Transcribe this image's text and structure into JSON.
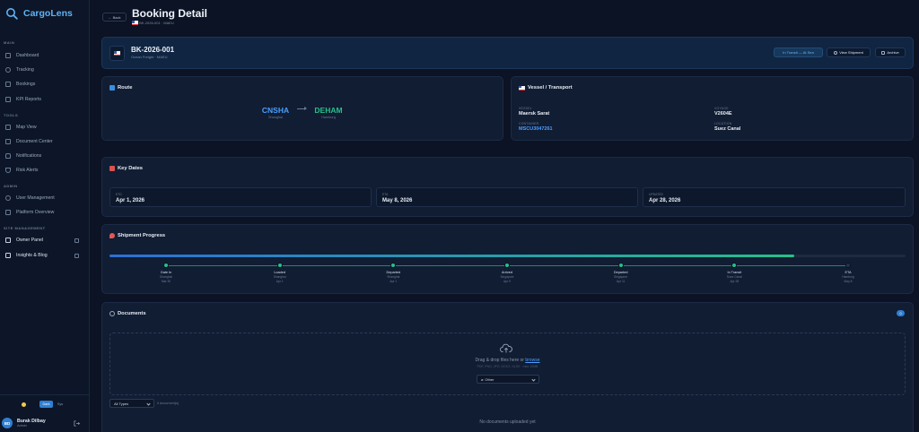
{
  "app": {
    "name": "CargoLens"
  },
  "sidebar": {
    "sections": [
      {
        "label": "MAIN",
        "items": [
          "Dashboard",
          "Tracking",
          "Bookings",
          "KPI Reports"
        ]
      },
      {
        "label": "TOOLS",
        "items": [
          "Map View",
          "Document Center",
          "Notifications",
          "Risk Alerts"
        ]
      },
      {
        "label": "ADMIN",
        "items": [
          "User Management",
          "Platform Overview"
        ]
      },
      {
        "label": "SITE MANAGEMENT",
        "items": [
          "Owner Panel",
          "Insights & Blog"
        ]
      }
    ],
    "theme": {
      "options": [
        "Dark",
        "Sys"
      ],
      "selected": "Dark"
    },
    "user": {
      "initials": "BD",
      "name": "Burak Dilbay",
      "role": "Admin"
    }
  },
  "header": {
    "back_label": "← Back",
    "title": "Booking Detail",
    "subtitle": "BK-2026-001 · MAEU"
  },
  "booking": {
    "number": "BK-2026-001",
    "subtitle": "Ocean Freight · MAEU",
    "status": "In Transit — At Sea",
    "view_label": "View Shipment",
    "archive_label": "Archive"
  },
  "route": {
    "title": "Route",
    "origin": {
      "code": "CNSHA",
      "city": "Shanghai",
      "color": "#4a9eff"
    },
    "destination": {
      "code": "DEHAM",
      "city": "Hamburg",
      "color": "#27c08a"
    }
  },
  "vessel": {
    "title": "Vessel / Transport",
    "fields": [
      {
        "label": "VESSEL",
        "value": "Maersk Sarat",
        "link": false
      },
      {
        "label": "VOYAGE",
        "value": "V2604E",
        "link": false
      },
      {
        "label": "CONTAINER",
        "value": "MSCU3047261",
        "link": true
      },
      {
        "label": "LOCATION",
        "value": "Suez Canal",
        "link": false
      }
    ]
  },
  "key_dates": {
    "title": "Key Dates",
    "items": [
      {
        "label": "ETD",
        "value": "Apr 1, 2026"
      },
      {
        "label": "ETA",
        "value": "May 8, 2026"
      },
      {
        "label": "UPDATED",
        "value": "Apr 28, 2026"
      }
    ]
  },
  "progress": {
    "title": "Shipment Progress",
    "percent": 86,
    "milestones": [
      {
        "name": "Gate In",
        "location": "Shanghai",
        "date": "Mar 30",
        "done": true
      },
      {
        "name": "Loaded",
        "location": "Shanghai",
        "date": "Apr 1",
        "done": true
      },
      {
        "name": "Departed",
        "location": "Shanghai",
        "date": "Apr 1",
        "done": true
      },
      {
        "name": "Arrived",
        "location": "Singapore",
        "date": "Apr 9",
        "done": true
      },
      {
        "name": "Departed",
        "location": "Singapore",
        "date": "Apr 11",
        "done": true
      },
      {
        "name": "In Transit",
        "location": "Suez Canal",
        "date": "Apr 28",
        "done": true
      },
      {
        "name": "ETA",
        "location": "Hamburg",
        "date": "May 8",
        "done": false
      }
    ]
  },
  "documents": {
    "title": "Documents",
    "count": "0",
    "drop_text": "Drag & drop files here or ",
    "browse_text": "browse",
    "hint": "PDF, PNG, JPG, DOCX, XLSX · max 10MB",
    "type_select": "Other",
    "filter": "All Types",
    "doc_count_text": "0 document(s)",
    "empty": "No documents uploaded yet"
  },
  "colors": {
    "accent": "#2f7fd3",
    "success": "#27c08a",
    "link": "#4a9eff"
  }
}
